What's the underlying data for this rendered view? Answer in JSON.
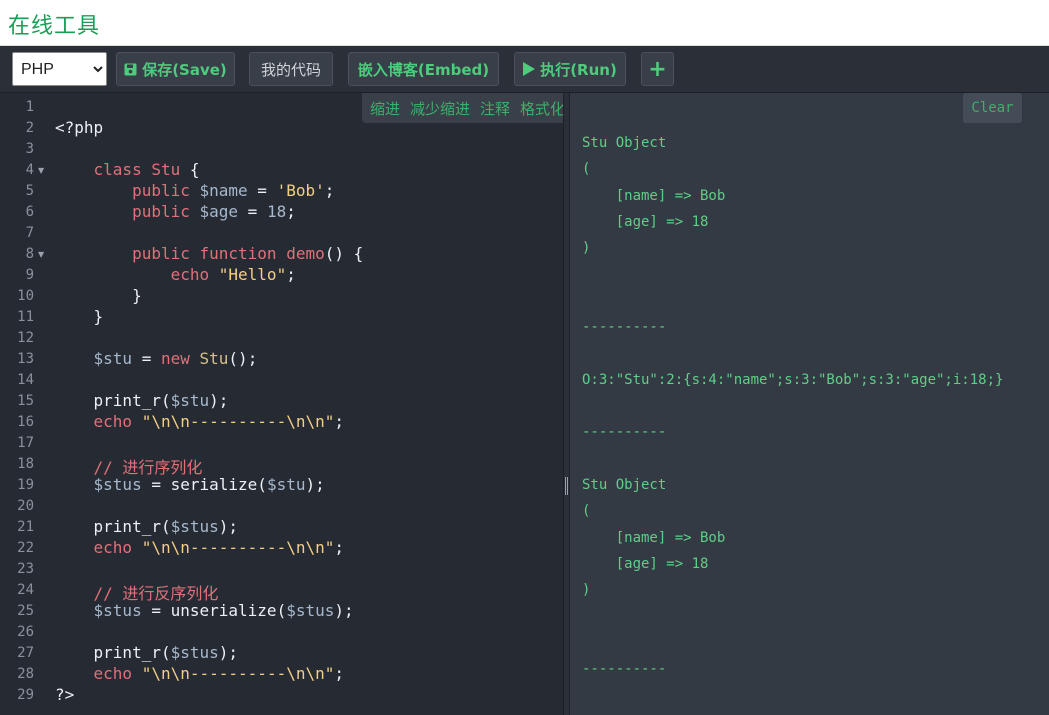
{
  "header": {
    "title": "在线工具"
  },
  "toolbar": {
    "language_selected": "PHP",
    "save_label": "保存(Save)",
    "mycode_label": "我的代码",
    "embed_label": "嵌入博客(Embed)",
    "run_label": "执行(Run)",
    "add_label": "+"
  },
  "editor_menu": [
    "缩进",
    "减少缩进",
    "注释",
    "格式化"
  ],
  "editor": {
    "line_numbers": [
      "1",
      "2",
      "3",
      "4",
      "5",
      "6",
      "7",
      "8",
      "9",
      "10",
      "11",
      "12",
      "13",
      "14",
      "15",
      "16",
      "17",
      "18",
      "19",
      "20",
      "21",
      "22",
      "23",
      "24",
      "25",
      "26",
      "27",
      "28",
      "29"
    ],
    "fold_markers": [
      4,
      8
    ],
    "lines": [
      [],
      [
        {
          "t": "<?php",
          "c": ""
        }
      ],
      [],
      [
        {
          "t": "    ",
          "c": ""
        },
        {
          "t": "class",
          "c": "kw"
        },
        {
          "t": " ",
          "c": ""
        },
        {
          "t": "Stu",
          "c": "kw"
        },
        {
          "t": " {",
          "c": ""
        }
      ],
      [
        {
          "t": "        ",
          "c": ""
        },
        {
          "t": "public",
          "c": "kw"
        },
        {
          "t": " ",
          "c": ""
        },
        {
          "t": "$name",
          "c": "var"
        },
        {
          "t": " = ",
          "c": ""
        },
        {
          "t": "'Bob'",
          "c": "str"
        },
        {
          "t": ";",
          "c": ""
        }
      ],
      [
        {
          "t": "        ",
          "c": ""
        },
        {
          "t": "public",
          "c": "kw"
        },
        {
          "t": " ",
          "c": ""
        },
        {
          "t": "$age",
          "c": "var"
        },
        {
          "t": " = ",
          "c": ""
        },
        {
          "t": "18",
          "c": "var"
        },
        {
          "t": ";",
          "c": ""
        }
      ],
      [],
      [
        {
          "t": "        ",
          "c": ""
        },
        {
          "t": "public",
          "c": "kw"
        },
        {
          "t": " ",
          "c": ""
        },
        {
          "t": "function",
          "c": "kw"
        },
        {
          "t": " ",
          "c": ""
        },
        {
          "t": "demo",
          "c": "kw"
        },
        {
          "t": "() {",
          "c": ""
        }
      ],
      [
        {
          "t": "            ",
          "c": ""
        },
        {
          "t": "echo",
          "c": "kw"
        },
        {
          "t": " ",
          "c": ""
        },
        {
          "t": "\"Hello\"",
          "c": "str"
        },
        {
          "t": ";",
          "c": ""
        }
      ],
      [
        {
          "t": "        }",
          "c": ""
        }
      ],
      [
        {
          "t": "    }",
          "c": ""
        }
      ],
      [],
      [
        {
          "t": "    ",
          "c": ""
        },
        {
          "t": "$stu",
          "c": "var"
        },
        {
          "t": " = ",
          "c": ""
        },
        {
          "t": "new",
          "c": "kw"
        },
        {
          "t": " ",
          "c": ""
        },
        {
          "t": "Stu",
          "c": "cls"
        },
        {
          "t": "();",
          "c": ""
        }
      ],
      [],
      [
        {
          "t": "    print_r(",
          "c": ""
        },
        {
          "t": "$stu",
          "c": "var"
        },
        {
          "t": ");",
          "c": ""
        }
      ],
      [
        {
          "t": "    ",
          "c": ""
        },
        {
          "t": "echo",
          "c": "kw"
        },
        {
          "t": " ",
          "c": ""
        },
        {
          "t": "\"",
          "c": "str"
        },
        {
          "t": "\\n\\n",
          "c": "esc"
        },
        {
          "t": "----------",
          "c": "str"
        },
        {
          "t": "\\n\\n",
          "c": "esc"
        },
        {
          "t": "\"",
          "c": "str"
        },
        {
          "t": ";",
          "c": ""
        }
      ],
      [],
      [
        {
          "t": "    // 进行序列化",
          "c": "cmt"
        }
      ],
      [
        {
          "t": "    ",
          "c": ""
        },
        {
          "t": "$stus",
          "c": "var"
        },
        {
          "t": " = serialize(",
          "c": ""
        },
        {
          "t": "$stu",
          "c": "var"
        },
        {
          "t": ");",
          "c": ""
        }
      ],
      [],
      [
        {
          "t": "    print_r(",
          "c": ""
        },
        {
          "t": "$stus",
          "c": "var"
        },
        {
          "t": ");",
          "c": ""
        }
      ],
      [
        {
          "t": "    ",
          "c": ""
        },
        {
          "t": "echo",
          "c": "kw"
        },
        {
          "t": " ",
          "c": ""
        },
        {
          "t": "\"",
          "c": "str"
        },
        {
          "t": "\\n\\n",
          "c": "esc"
        },
        {
          "t": "----------",
          "c": "str"
        },
        {
          "t": "\\n\\n",
          "c": "esc"
        },
        {
          "t": "\"",
          "c": "str"
        },
        {
          "t": ";",
          "c": ""
        }
      ],
      [],
      [
        {
          "t": "    // 进行反序列化",
          "c": "cmt"
        }
      ],
      [
        {
          "t": "    ",
          "c": ""
        },
        {
          "t": "$stus",
          "c": "var"
        },
        {
          "t": " = unserialize(",
          "c": ""
        },
        {
          "t": "$stus",
          "c": "var"
        },
        {
          "t": ");",
          "c": ""
        }
      ],
      [],
      [
        {
          "t": "    print_r(",
          "c": ""
        },
        {
          "t": "$stus",
          "c": "var"
        },
        {
          "t": ");",
          "c": ""
        }
      ],
      [
        {
          "t": "    ",
          "c": ""
        },
        {
          "t": "echo",
          "c": "kw"
        },
        {
          "t": " ",
          "c": ""
        },
        {
          "t": "\"",
          "c": "str"
        },
        {
          "t": "\\n\\n",
          "c": "esc"
        },
        {
          "t": "----------",
          "c": "str"
        },
        {
          "t": "\\n\\n",
          "c": "esc"
        },
        {
          "t": "\"",
          "c": "str"
        },
        {
          "t": ";",
          "c": ""
        }
      ],
      [
        {
          "t": "?>",
          "c": ""
        }
      ]
    ]
  },
  "output": {
    "clear_label": "Clear",
    "lines": [
      "Stu Object",
      "(",
      "    [name] => Bob",
      "    [age] => 18",
      ")",
      "",
      "",
      "----------",
      "",
      "O:3:\"Stu\":2:{s:4:\"name\";s:3:\"Bob\";s:3:\"age\";i:18;}",
      "",
      "----------",
      "",
      "Stu Object",
      "(",
      "    [name] => Bob",
      "    [age] => 18",
      ")",
      "",
      "",
      "----------"
    ]
  },
  "colors": {
    "accent_green": "#4ecb7c",
    "title_green": "#1a9e57",
    "editor_bg": "#262b33",
    "output_bg": "#333a44"
  }
}
